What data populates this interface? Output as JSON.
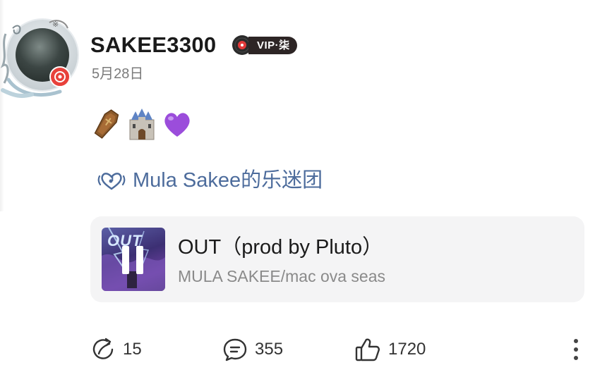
{
  "user": {
    "username": "SAKEE3300",
    "vip_badge": "VIP·柒",
    "post_date": "5月28日"
  },
  "post": {
    "emojis": [
      "coffin-emoji",
      "castle-emoji",
      "purple-heart-emoji"
    ],
    "fan_group_label": "Mula Sakee的乐迷团"
  },
  "music": {
    "cover_text": "OUT",
    "title": "OUT（prod by Pluto）",
    "artist": "MULA SAKEE/mac ova seas"
  },
  "actions": {
    "share_count": "15",
    "comment_count": "355",
    "like_count": "1720"
  },
  "colors": {
    "fan_group_blue": "#4d6c9c",
    "vip_badge_bg": "#2d2525",
    "avatar_badge_red": "#e8413b"
  }
}
